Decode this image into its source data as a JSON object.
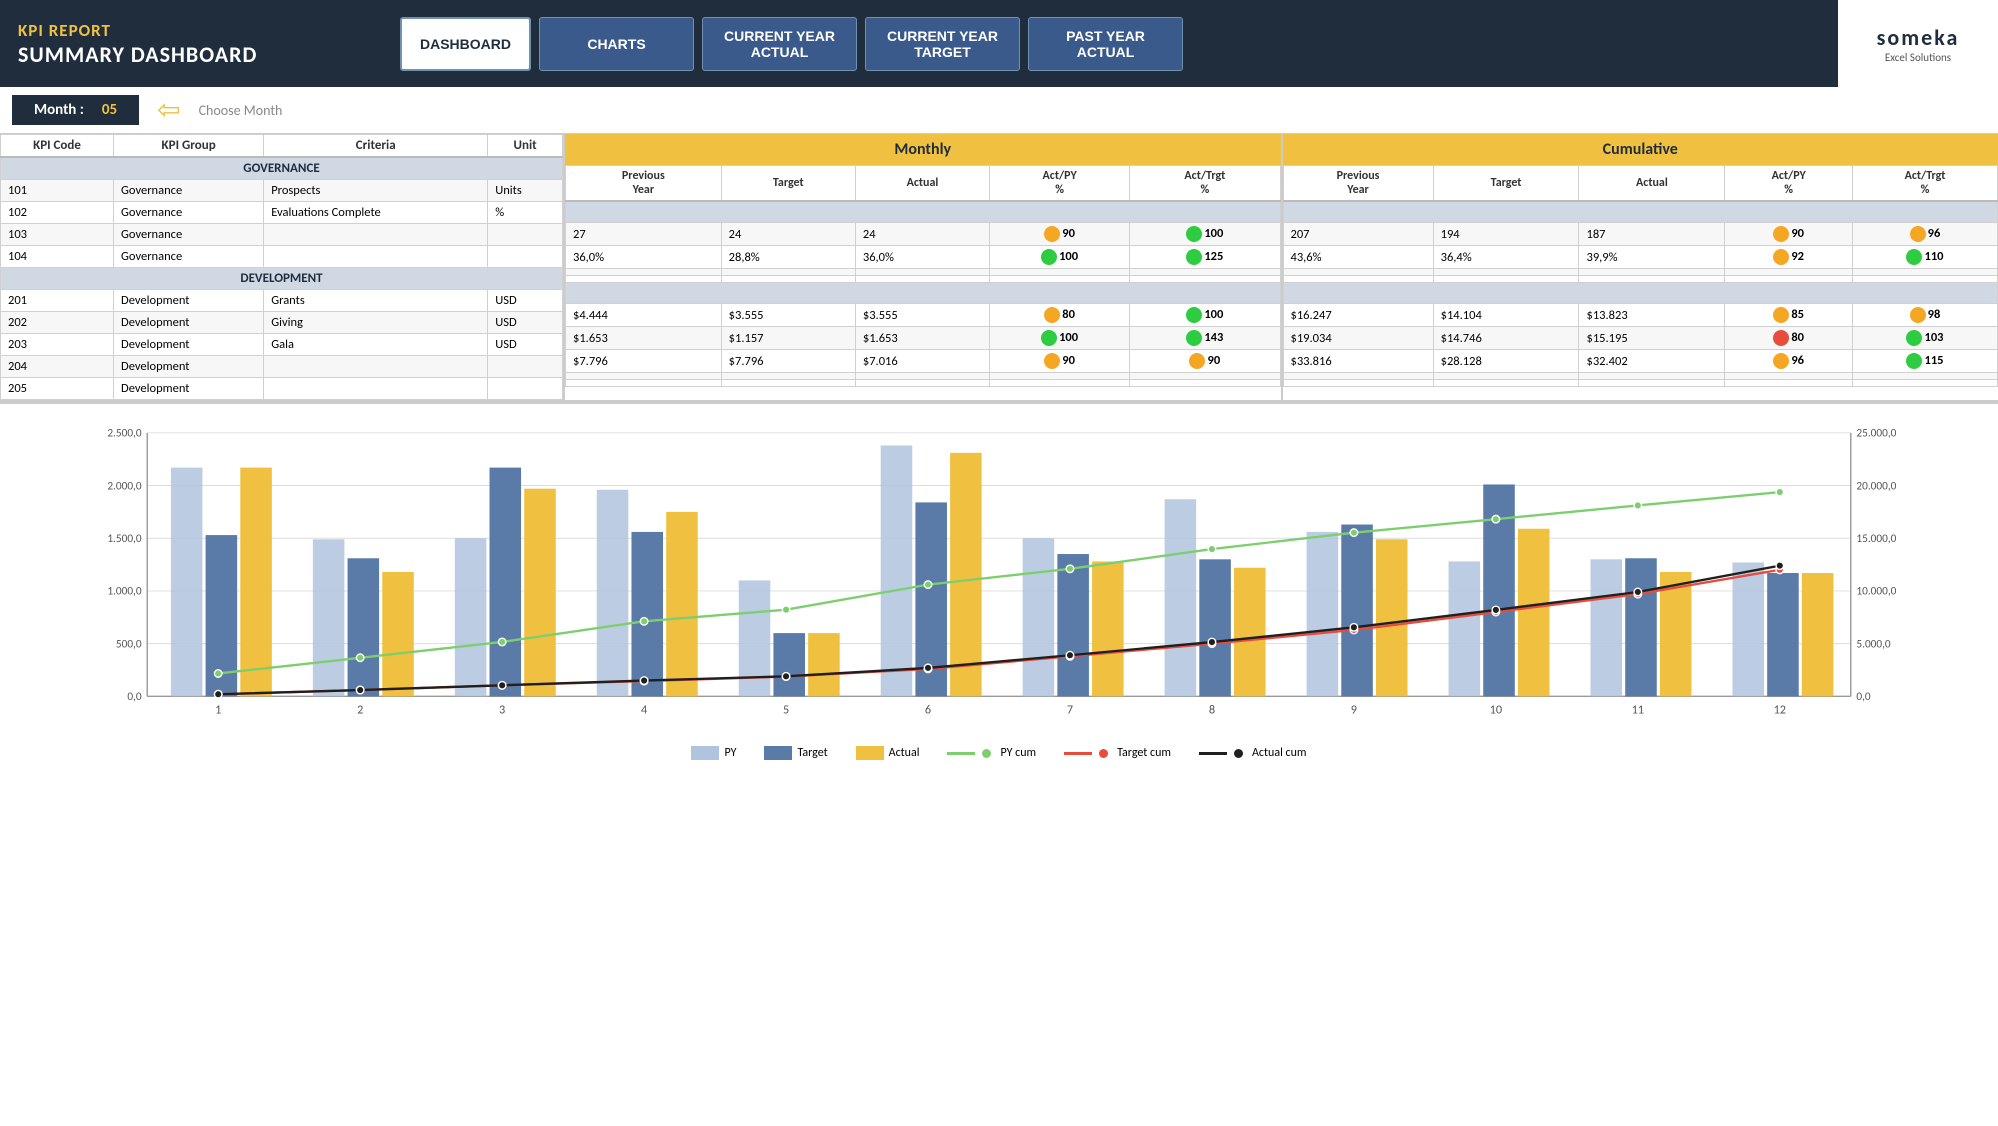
{
  "header": {
    "kpi_report_label": "KPI REPORT",
    "summary_label": "SUMMARY DASHBOARD",
    "nav": {
      "dashboard": "DASHBOARD",
      "charts": "CHARTS",
      "current_year_actual": "CURRENT YEAR\nACTUAL",
      "current_year_target": "CURRENT YEAR\nTARGET",
      "past_year_actual": "PAST YEAR\nACTUAL"
    },
    "logo": {
      "brand": "someka",
      "sub": "Excel Solutions"
    }
  },
  "month_selector": {
    "label": "Month :",
    "value": "05",
    "choose_label": "Choose Month"
  },
  "kpi_table": {
    "columns": [
      "KPI Code",
      "KPI Group",
      "Criteria",
      "Unit"
    ],
    "sections": [
      {
        "name": "GOVERNANCE",
        "rows": [
          {
            "code": "101",
            "group": "Governance",
            "criteria": "Prospects",
            "unit": "Units"
          },
          {
            "code": "102",
            "group": "Governance",
            "criteria": "Evaluations Complete",
            "unit": "%"
          },
          {
            "code": "103",
            "group": "Governance",
            "criteria": "",
            "unit": ""
          },
          {
            "code": "104",
            "group": "Governance",
            "criteria": "",
            "unit": ""
          }
        ]
      },
      {
        "name": "DEVELOPMENT",
        "rows": [
          {
            "code": "201",
            "group": "Development",
            "criteria": "Grants",
            "unit": "USD"
          },
          {
            "code": "202",
            "group": "Development",
            "criteria": "Giving",
            "unit": "USD"
          },
          {
            "code": "203",
            "group": "Development",
            "criteria": "Gala",
            "unit": "USD"
          },
          {
            "code": "204",
            "group": "Development",
            "criteria": "",
            "unit": ""
          },
          {
            "code": "205",
            "group": "Development",
            "criteria": "",
            "unit": ""
          }
        ]
      }
    ]
  },
  "monthly_panel": {
    "title": "Monthly",
    "columns": [
      "Previous Year",
      "Target",
      "Actual",
      "Act/PY %",
      "Act/Trgt %"
    ],
    "rows": [
      {
        "prev_year": "27",
        "target": "24",
        "actual": "24",
        "act_py": "90",
        "act_py_dot": "orange",
        "act_trgt": "100",
        "act_trgt_dot": "green"
      },
      {
        "prev_year": "36,0%",
        "target": "28,8%",
        "actual": "36,0%",
        "act_py": "100",
        "act_py_dot": "green",
        "act_trgt": "125",
        "act_trgt_dot": "green"
      },
      {
        "prev_year": "",
        "target": "",
        "actual": "",
        "act_py": "",
        "act_py_dot": "",
        "act_trgt": "",
        "act_trgt_dot": ""
      },
      {
        "prev_year": "",
        "target": "",
        "actual": "",
        "act_py": "",
        "act_py_dot": "",
        "act_trgt": "",
        "act_trgt_dot": ""
      },
      {
        "prev_year": "$4.444",
        "target": "$3.555",
        "actual": "$3.555",
        "act_py": "80",
        "act_py_dot": "orange",
        "act_trgt": "100",
        "act_trgt_dot": "green"
      },
      {
        "prev_year": "$1.653",
        "target": "$1.157",
        "actual": "$1.653",
        "act_py": "100",
        "act_py_dot": "green",
        "act_trgt": "143",
        "act_trgt_dot": "green"
      },
      {
        "prev_year": "$7.796",
        "target": "$7.796",
        "actual": "$7.016",
        "act_py": "90",
        "act_py_dot": "orange",
        "act_trgt": "90",
        "act_trgt_dot": "orange"
      },
      {
        "prev_year": "",
        "target": "",
        "actual": "",
        "act_py": "",
        "act_py_dot": "",
        "act_trgt": "",
        "act_trgt_dot": ""
      },
      {
        "prev_year": "",
        "target": "",
        "actual": "",
        "act_py": "",
        "act_py_dot": "",
        "act_trgt": "",
        "act_trgt_dot": ""
      }
    ]
  },
  "cumulative_panel": {
    "title": "Cumulative",
    "columns": [
      "Previous Year",
      "Target",
      "Actual",
      "Act/PY %",
      "Act/Trgt %"
    ],
    "rows": [
      {
        "prev_year": "207",
        "target": "194",
        "actual": "187",
        "act_py": "90",
        "act_py_dot": "orange",
        "act_trgt": "96",
        "act_trgt_dot": "orange"
      },
      {
        "prev_year": "43,6%",
        "target": "36,4%",
        "actual": "39,9%",
        "act_py": "92",
        "act_py_dot": "orange",
        "act_trgt": "110",
        "act_trgt_dot": "green"
      },
      {
        "prev_year": "",
        "target": "",
        "actual": "",
        "act_py": "",
        "act_py_dot": "",
        "act_trgt": "",
        "act_trgt_dot": ""
      },
      {
        "prev_year": "",
        "target": "",
        "actual": "",
        "act_py": "",
        "act_py_dot": "",
        "act_trgt": "",
        "act_trgt_dot": ""
      },
      {
        "prev_year": "$16.247",
        "target": "$14.104",
        "actual": "$13.823",
        "act_py": "85",
        "act_py_dot": "orange",
        "act_trgt": "98",
        "act_trgt_dot": "orange"
      },
      {
        "prev_year": "$19.034",
        "target": "$14.746",
        "actual": "$15.195",
        "act_py": "80",
        "act_py_dot": "red",
        "act_trgt": "103",
        "act_trgt_dot": "green"
      },
      {
        "prev_year": "$33.816",
        "target": "$28.128",
        "actual": "$32.402",
        "act_py": "96",
        "act_py_dot": "orange",
        "act_trgt": "115",
        "act_trgt_dot": "green"
      },
      {
        "prev_year": "",
        "target": "",
        "actual": "",
        "act_py": "",
        "act_py_dot": "",
        "act_trgt": "",
        "act_trgt_dot": ""
      },
      {
        "prev_year": "",
        "target": "",
        "actual": "",
        "act_py": "",
        "act_py_dot": "",
        "act_trgt": "",
        "act_trgt_dot": ""
      }
    ]
  },
  "chart": {
    "y_axis_left": [
      "0,0",
      "500,0",
      "1.000,0",
      "1.500,0",
      "2.000,0",
      "2.500,0"
    ],
    "y_axis_right": [
      "0,0",
      "5.000,0",
      "10.000,0",
      "15.000,0",
      "20.000,0",
      "25.000,0"
    ],
    "x_axis": [
      "1",
      "2",
      "3",
      "4",
      "5",
      "6",
      "7",
      "8",
      "9",
      "10",
      "11",
      "12"
    ],
    "legend": [
      {
        "label": "PY",
        "type": "bar",
        "color": "#b0c4de"
      },
      {
        "label": "Target",
        "type": "bar",
        "color": "#5a7aa8"
      },
      {
        "label": "Actual",
        "type": "bar",
        "color": "#f0c040"
      },
      {
        "label": "PY cum",
        "type": "line",
        "color": "#7dcf6e"
      },
      {
        "label": "Target cum",
        "type": "line",
        "color": "#e74c3c"
      },
      {
        "label": "Actual cum",
        "type": "line",
        "color": "#1f1f1f"
      }
    ],
    "bar_data": {
      "py": [
        2170,
        1490,
        1500,
        1960,
        1100,
        2380,
        1500,
        1870,
        1560,
        1280,
        1300,
        1270
      ],
      "target": [
        1530,
        1310,
        2170,
        1560,
        600,
        1840,
        1350,
        1300,
        1630,
        2010,
        1310,
        1170
      ],
      "actual": [
        2170,
        1180,
        1970,
        1750,
        600,
        2310,
        1280,
        1220,
        1490,
        1590,
        1180,
        1170
      ]
    },
    "line_data": {
      "py_cum": [
        2170,
        3660,
        5160,
        7120,
        8220,
        10600,
        12100,
        13970,
        15530,
        16810,
        18110,
        19380
      ],
      "target_cum": [
        200,
        600,
        1050,
        1450,
        1880,
        2600,
        3800,
        5000,
        6300,
        8000,
        9700,
        12000
      ],
      "actual_cum": [
        200,
        600,
        1050,
        1500,
        1900,
        2700,
        3900,
        5150,
        6550,
        8200,
        9900,
        12400
      ]
    }
  }
}
